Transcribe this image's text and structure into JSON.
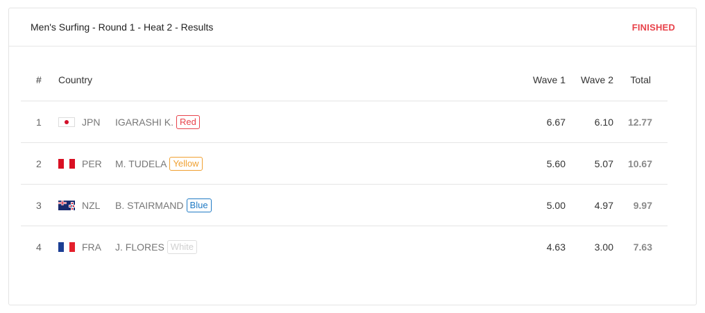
{
  "header": {
    "title": "Men's Surfing - Round 1 - Heat 2 - Results",
    "status": "FINISHED"
  },
  "table": {
    "columns": {
      "rank": "#",
      "country": "Country",
      "wave1": "Wave 1",
      "wave2": "Wave 2",
      "total": "Total"
    },
    "rows": [
      {
        "rank": "1",
        "flag": "japan-flag-icon",
        "code": "JPN",
        "name": "IGARASHI K.",
        "jersey": "Red",
        "wave1": "6.67",
        "wave2": "6.10",
        "total": "12.77"
      },
      {
        "rank": "2",
        "flag": "peru-flag-icon",
        "code": "PER",
        "name": "M. TUDELA",
        "jersey": "Yellow",
        "wave1": "5.60",
        "wave2": "5.07",
        "total": "10.67"
      },
      {
        "rank": "3",
        "flag": "new-zealand-flag-icon",
        "code": "NZL",
        "name": "B. STAIRMAND",
        "jersey": "Blue",
        "wave1": "5.00",
        "wave2": "4.97",
        "total": "9.97"
      },
      {
        "rank": "4",
        "flag": "france-flag-icon",
        "code": "FRA",
        "name": "J. FLORES",
        "jersey": "White",
        "wave1": "4.63",
        "wave2": "3.00",
        "total": "7.63"
      }
    ]
  },
  "colors": {
    "status": "#e8434b",
    "jersey_red": "#e8434b",
    "jersey_yellow": "#f0a030",
    "jersey_blue": "#1f7ac4",
    "jersey_white": "#d0d0d0"
  }
}
